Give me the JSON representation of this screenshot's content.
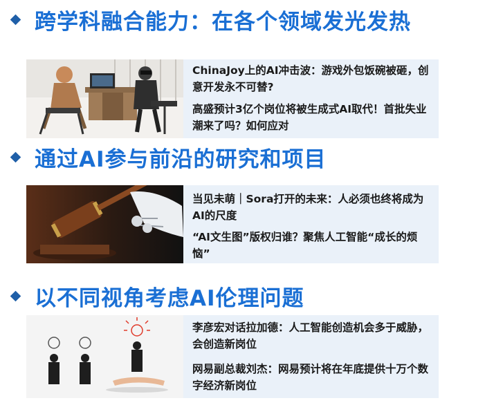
{
  "sections": [
    {
      "heading": "跨学科融合能力：在各个领域发光发热",
      "icon": "robot-and-human-at-desk-image",
      "items": [
        "ChinaJoy上的AI冲击波：游戏外包饭碗被砸，创意开发永不可替?",
        "高盛预计3亿个岗位将被生成式AI取代！首批失业潮来了吗？如何应对"
      ]
    },
    {
      "heading": "通过AI参与前沿的研究和项目",
      "icon": "robot-hand-gavel-image",
      "items": [
        "当见未萌｜Sora打开的未来：人必须也终将成为AI的尺度",
        "“AI文生图”版权归谁？聚焦人工智能“成长的烦恼”"
      ]
    },
    {
      "heading": "以不同视角考虑AI伦理问题",
      "icon": "businessmen-lightbulb-image",
      "items": [
        "李彦宏对话拉加德：人工智能创造机会多于威胁，会创造新岗位",
        "网易副总裁刘杰：网易预计将在年底提供十万个数字经济新岗位"
      ]
    }
  ],
  "colors": {
    "heading": "#1a6fd4",
    "bullet": "#1f5fa8",
    "card_background": "#eaf1f9",
    "item_text": "#1a1a1a"
  }
}
